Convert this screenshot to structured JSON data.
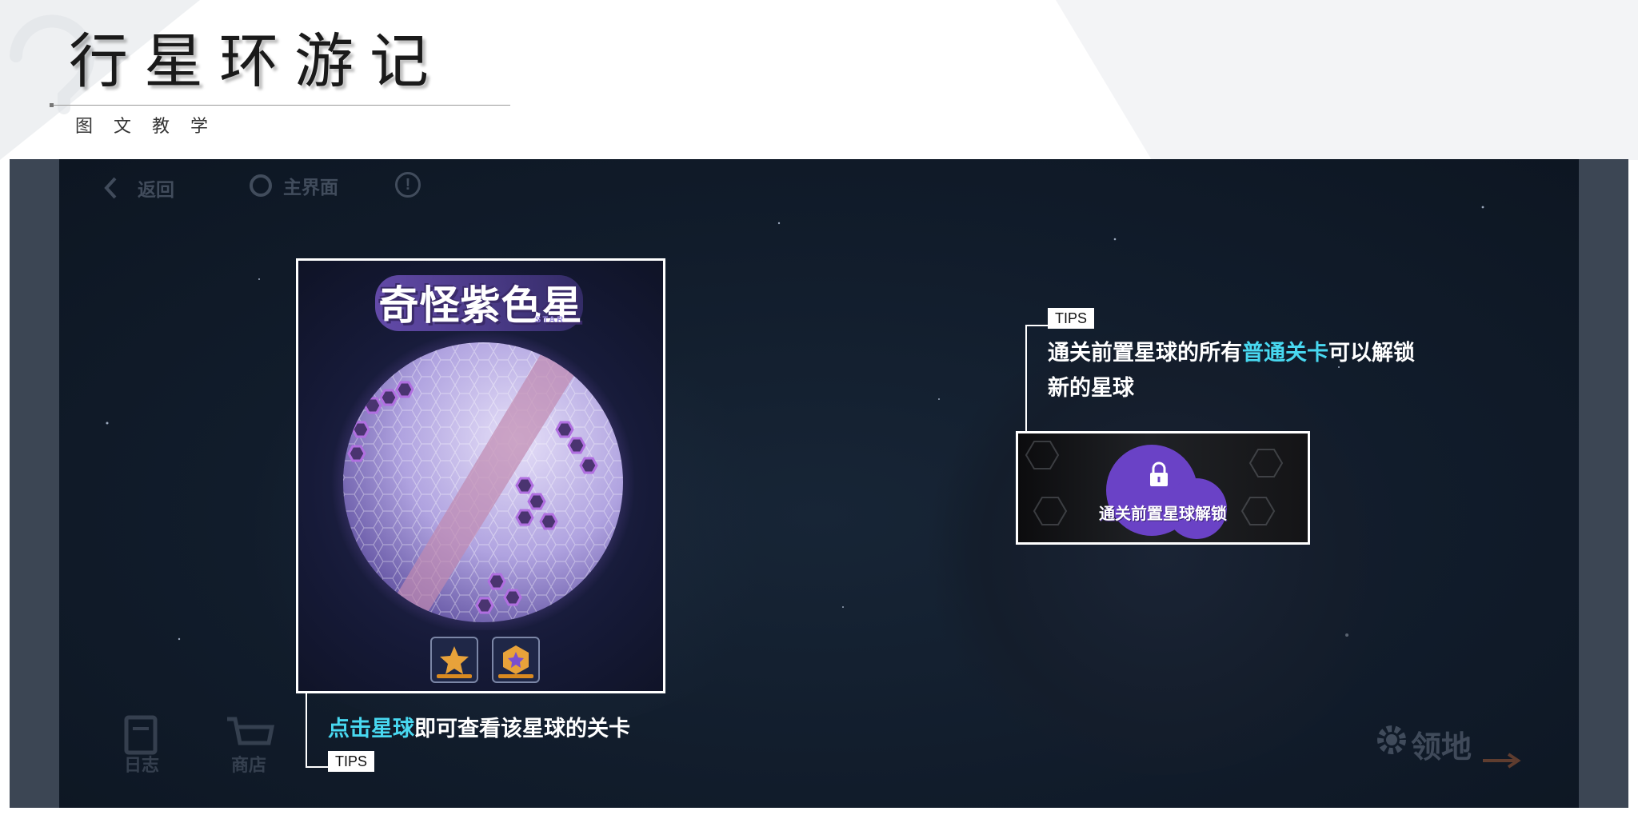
{
  "slide": {
    "title": "行星环游记",
    "subtitle": "图文教学"
  },
  "game": {
    "nav": {
      "back_label": "返回",
      "home_label": "主界面",
      "info_symbol": "!"
    },
    "planet_card": {
      "planet_name": "奇怪紫色星",
      "planet_name_sub": "STAR"
    },
    "tip_left": {
      "tag": "TIPS",
      "text_highlight": "点击星球",
      "text_rest": "即可查看该星球的关卡"
    },
    "tip_right": {
      "tag": "TIPS",
      "text_part1": "通关前置星球的所有",
      "text_highlight": "普通关卡",
      "text_part2": "可以解锁新的星球"
    },
    "lock_card": {
      "text": "通关前置星球解锁"
    },
    "dock": {
      "diary_label": "日志",
      "shop_label": "商店",
      "territory_label": "领地"
    }
  },
  "colors": {
    "highlight": "#48d8f0",
    "lock_purple": "#6a42c6",
    "game_bg": "#111c2b"
  },
  "icons": [
    "back-chevron-icon",
    "home-circle-icon",
    "info-icon",
    "lock-icon",
    "diary-icon",
    "shop-cart-icon",
    "gear-icon",
    "arrow-icon"
  ]
}
